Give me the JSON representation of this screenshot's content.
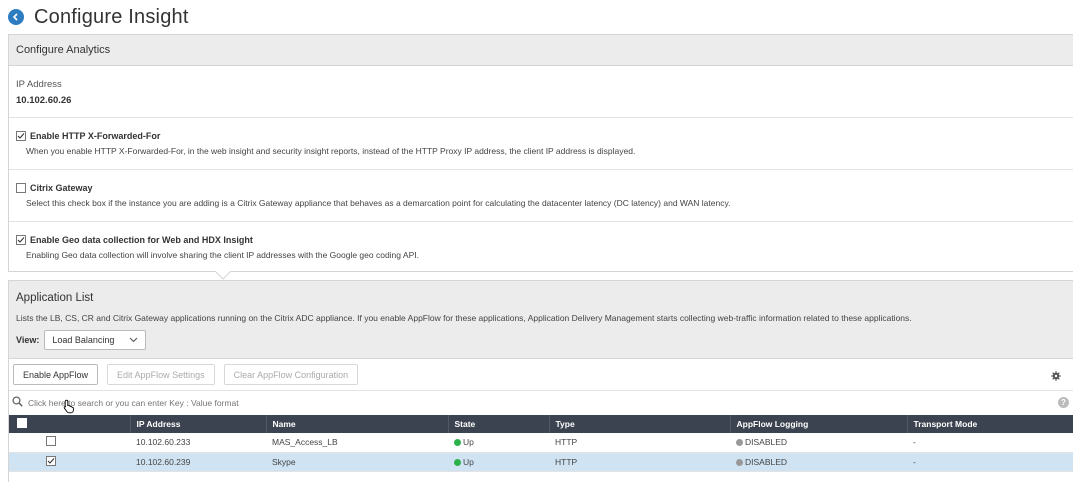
{
  "page": {
    "title": "Configure Insight"
  },
  "analytics": {
    "header": "Configure Analytics",
    "ip_label": "IP Address",
    "ip_value": "10.102.60.26",
    "options": [
      {
        "label": "Enable HTTP X-Forwarded-For",
        "checked": true,
        "help": "When you enable HTTP X-Forwarded-For, in the web insight and security insight reports, instead of the HTTP Proxy IP address, the client IP address is displayed."
      },
      {
        "label": "Citrix Gateway",
        "checked": false,
        "help": "Select this check box if the instance you are adding is a Citrix Gateway appliance that behaves as a demarcation point for calculating the datacenter latency (DC latency) and WAN latency."
      },
      {
        "label": "Enable Geo data collection for Web and HDX Insight",
        "checked": true,
        "help": "Enabling Geo data collection will involve sharing the client IP addresses with the Google geo coding API."
      }
    ]
  },
  "apps": {
    "title": "Application List",
    "description": "Lists the LB, CS, CR and Citrix Gateway applications running on the Citrix ADC appliance. If you enable AppFlow for these applications, Application Delivery Management starts collecting web-traffic information related to these applications.",
    "view_label": "View:",
    "view_value": "Load Balancing"
  },
  "toolbar": {
    "enable": "Enable AppFlow",
    "edit": "Edit AppFlow Settings",
    "clear": "Clear AppFlow Configuration"
  },
  "search": {
    "placeholder": "Click here to search or you can enter Key : Value format"
  },
  "help_glyph": "?",
  "table": {
    "columns": [
      "IP Address",
      "Name",
      "State",
      "Type",
      "AppFlow Logging",
      "Transport Mode"
    ],
    "rows": [
      {
        "checked": false,
        "ip": "10.102.60.233",
        "name": "MAS_Access_LB",
        "state": "Up",
        "type": "HTTP",
        "logging": "DISABLED",
        "transport": "-"
      },
      {
        "checked": true,
        "ip": "10.102.60.239",
        "name": "Skype",
        "state": "Up",
        "type": "HTTP",
        "logging": "DISABLED",
        "transport": "-"
      }
    ]
  },
  "colors": {
    "accent": "#2f7dc1",
    "table_header": "#3c4350",
    "selected_row": "#cfe3f3",
    "status_up": "#2db14a",
    "status_disabled": "#999999"
  },
  "icons": [
    "back-icon",
    "checkbox-icon",
    "chevron-down-icon",
    "gear-icon",
    "search-icon",
    "help-icon",
    "status-dot-icon",
    "pointer-cursor-icon"
  ]
}
